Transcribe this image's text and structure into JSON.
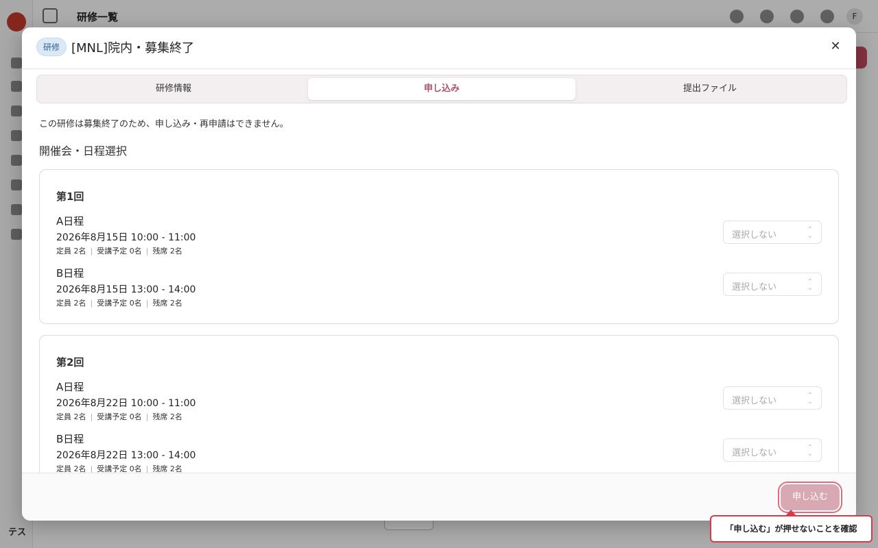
{
  "background": {
    "page_title": "研修一覧",
    "user_initial": "F",
    "sidebar_bottom_label": "テス"
  },
  "modal": {
    "badge": "研修",
    "title": "[MNL]院内・募集終了",
    "tabs": [
      {
        "label": "研修情報",
        "active": false
      },
      {
        "label": "申し込み",
        "active": true
      },
      {
        "label": "提出ファイル",
        "active": false
      }
    ],
    "notice": "この研修は募集終了のため、申し込み・再申請はできません。",
    "section_heading": "開催会・日程選択",
    "sessions": [
      {
        "title": "第1回",
        "schedules": [
          {
            "name": "A日程",
            "datetime": "2026年8月15日 10:00 - 11:00",
            "capacity": "定員 2名",
            "planned": "受講予定 0名",
            "remaining": "残席 2名",
            "select": "選択しない"
          },
          {
            "name": "B日程",
            "datetime": "2026年8月15日 13:00 - 14:00",
            "capacity": "定員 2名",
            "planned": "受講予定 0名",
            "remaining": "残席 2名",
            "select": "選択しない"
          }
        ]
      },
      {
        "title": "第2回",
        "schedules": [
          {
            "name": "A日程",
            "datetime": "2026年8月22日 10:00 - 11:00",
            "capacity": "定員 2名",
            "planned": "受講予定 0名",
            "remaining": "残席 2名",
            "select": "選択しない"
          },
          {
            "name": "B日程",
            "datetime": "2026年8月22日 13:00 - 14:00",
            "capacity": "定員 2名",
            "planned": "受講予定 0名",
            "remaining": "残席 2名",
            "select": "選択しない"
          }
        ]
      }
    ],
    "footer": {
      "apply_label": "申し込む"
    }
  },
  "annotation": {
    "text": "「申し込む」が押せないことを確認"
  },
  "colors": {
    "accent": "#b0536a",
    "disabled_button": "#d9a9b3",
    "annotation_border": "#d83a4b",
    "badge_bg": "#dbe9f7"
  }
}
